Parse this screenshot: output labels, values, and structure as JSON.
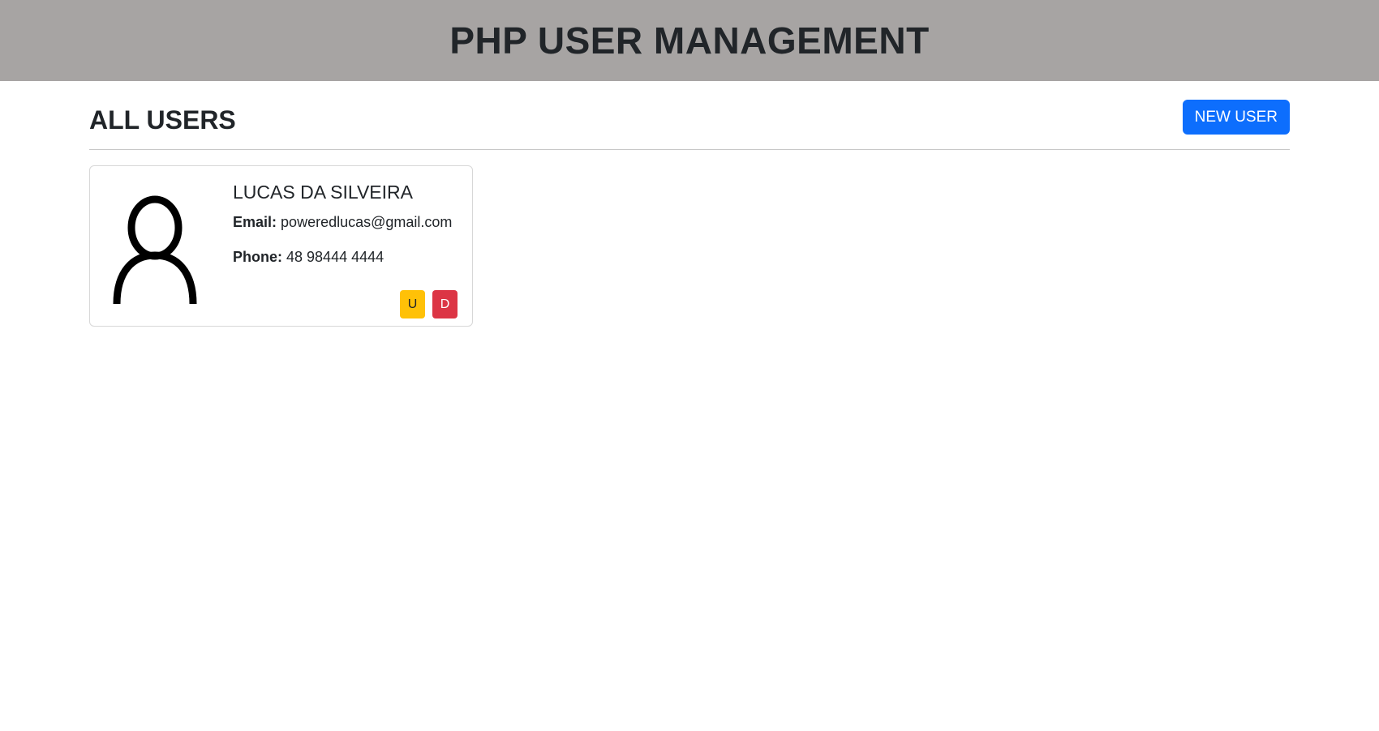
{
  "header": {
    "title": "PHP USER MANAGEMENT"
  },
  "toolbar": {
    "section_title": "ALL USERS",
    "new_user_label": "NEW USER"
  },
  "users": [
    {
      "name": "LUCAS DA SILVEIRA",
      "email_label": "Email:",
      "email": "poweredlucas@gmail.com",
      "phone_label": "Phone:",
      "phone": "48 98444 4444",
      "avatar_icon": "person-outline-icon",
      "update_label": "U",
      "delete_label": "D"
    }
  ],
  "colors": {
    "header_bg": "#a7a4a3",
    "primary": "#0d6efd",
    "warning": "#ffc107",
    "danger": "#dc3545"
  }
}
